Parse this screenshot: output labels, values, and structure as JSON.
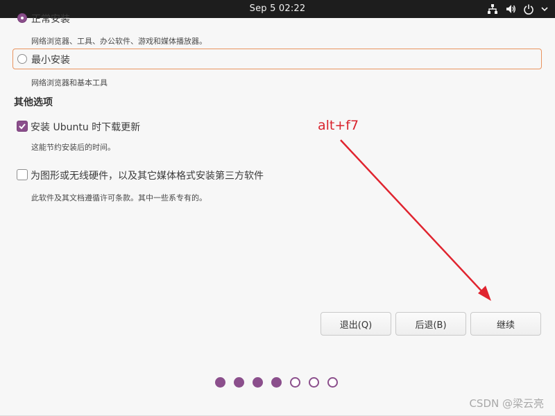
{
  "topbar": {
    "clock": "Sep 5  02:22",
    "icons": [
      "network-icon",
      "volume-icon",
      "power-icon",
      "menu-chevron-icon"
    ]
  },
  "install_type": {
    "normal": {
      "label": "正常安装",
      "description": "网络浏览器、工具、办公软件、游戏和媒体播放器。",
      "selected": true
    },
    "minimal": {
      "label": "最小安装",
      "description": "网络浏览器和基本工具",
      "selected": false
    }
  },
  "other_options": {
    "title": "其他选项",
    "download_updates": {
      "label": "安装 Ubuntu 时下载更新",
      "description": "这能节约安装后的时间。",
      "checked": true
    },
    "third_party": {
      "label": "为图形或无线硬件，以及其它媒体格式安装第三方软件",
      "description": "此软件及其文档遵循许可条款。其中一些系专有的。",
      "checked": false
    }
  },
  "annotation": {
    "text": "alt+f7",
    "color": "#d9232d"
  },
  "buttons": {
    "quit": "退出(Q)",
    "back": "后退(B)",
    "continue": "继续"
  },
  "progress": {
    "total": 7,
    "completed": 4
  },
  "watermark": "CSDN @梁云亮",
  "colors": {
    "accent": "#8b4f8c",
    "focus_border": "#e9935e",
    "topbar": "#1d1d1d"
  }
}
